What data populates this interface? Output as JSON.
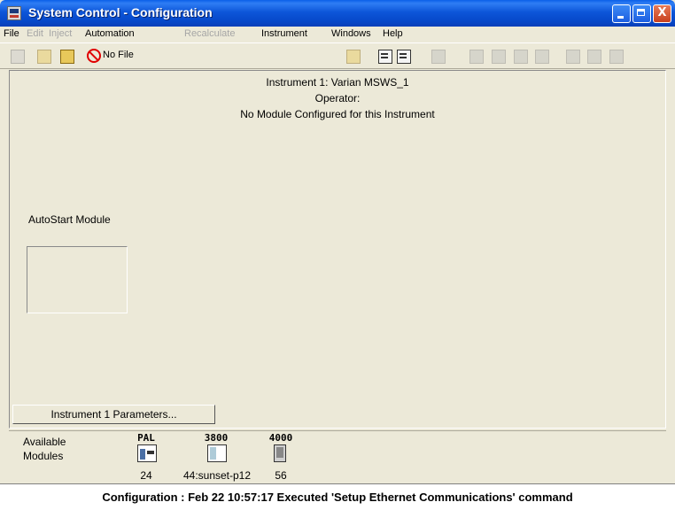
{
  "window": {
    "title": "System Control - Configuration",
    "minimize_label": "",
    "maximize_label": "",
    "close_label": "X"
  },
  "menu": {
    "items": [
      {
        "label": "File",
        "enabled": true
      },
      {
        "label": "Edit",
        "enabled": false
      },
      {
        "label": "Inject",
        "enabled": false
      },
      {
        "label": "Automation",
        "enabled": true
      },
      {
        "label": "Recalculate",
        "enabled": false
      },
      {
        "label": "Instrument",
        "enabled": true
      },
      {
        "label": "Windows",
        "enabled": true
      },
      {
        "label": "Help",
        "enabled": true
      }
    ]
  },
  "toolbar": {
    "method_file_label": "No File",
    "icons": [
      "new-icon",
      "open-folder-icon",
      "folder-icon",
      "no-file-icon",
      "open-folder-icon",
      "method-notes-icon",
      "method-view-icon",
      "instrument-icon",
      "inject-icon",
      "recalc-icon",
      "sample-list-icon",
      "sequence-icon",
      "pause-icon",
      "play-icon",
      "stop-icon"
    ]
  },
  "main": {
    "instrument_line": "Instrument 1: Varian MSWS_1",
    "operator_line": "Operator:",
    "module_status": "No Module Configured for this Instrument",
    "autostart_label": "AutoStart Module",
    "params_button": "Instrument 1 Parameters..."
  },
  "modules": {
    "label": "Available Modules",
    "items": [
      {
        "name": "PAL",
        "number": "24"
      },
      {
        "name": "3800",
        "number": "44:sunset-p12"
      },
      {
        "name": "4000",
        "number": "56"
      }
    ]
  },
  "status": {
    "text": "Configuration : Feb 22 10:57:17  Executed 'Setup Ethernet Communications' command"
  }
}
